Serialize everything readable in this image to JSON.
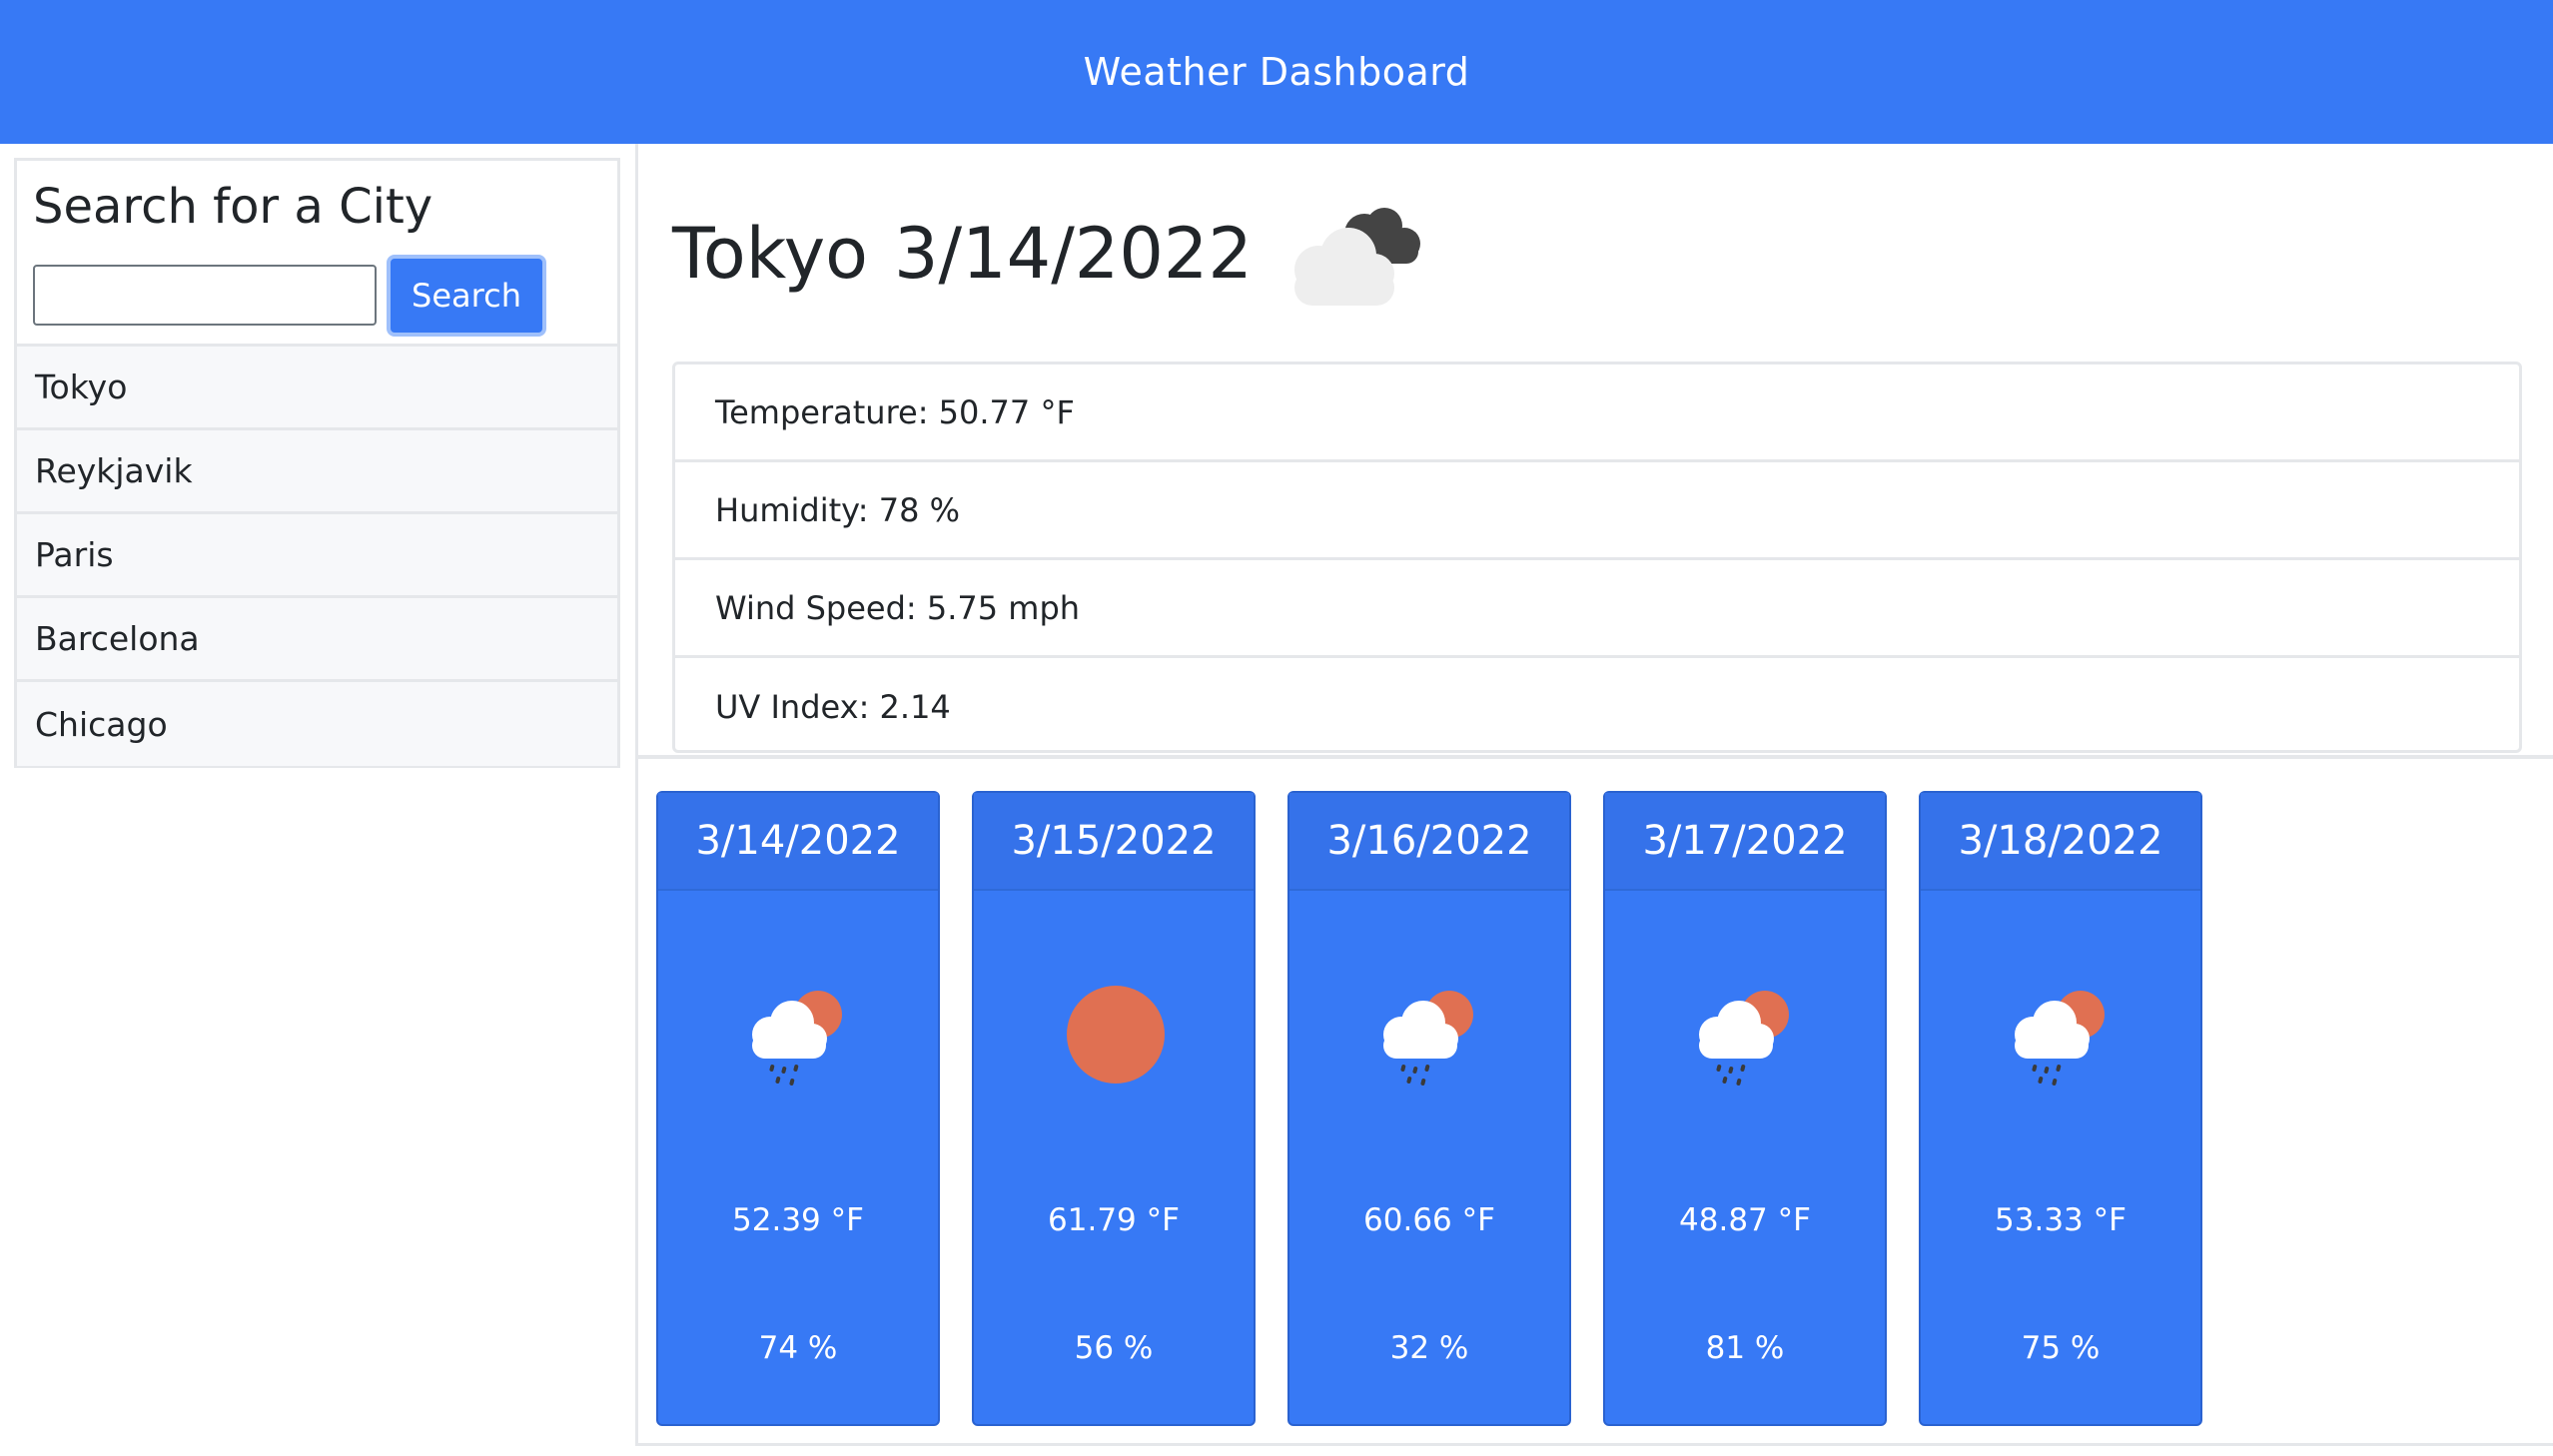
{
  "header": {
    "title": "Weather Dashboard"
  },
  "sidebar": {
    "heading": "Search for a City",
    "search": {
      "value": "",
      "placeholder": "",
      "button_label": "Search"
    },
    "cities": [
      "Tokyo",
      "Reykjavik",
      "Paris",
      "Barcelona",
      "Chicago"
    ]
  },
  "current": {
    "city": "Tokyo",
    "date": "3/14/2022",
    "icon": "broken-clouds-icon",
    "temperature": "Temperature: 50.77 °F",
    "humidity": "Humidity: 78 %",
    "wind": "Wind Speed: 5.75 mph",
    "uv": "UV Index: 2.14"
  },
  "forecast": [
    {
      "date": "3/14/2022",
      "icon": "rain-icon",
      "temp": "52.39 °F",
      "humidity": "74 %"
    },
    {
      "date": "3/15/2022",
      "icon": "clear-sky-icon",
      "temp": "61.79 °F",
      "humidity": "56 %"
    },
    {
      "date": "3/16/2022",
      "icon": "rain-icon",
      "temp": "60.66 °F",
      "humidity": "32 %"
    },
    {
      "date": "3/17/2022",
      "icon": "rain-icon",
      "temp": "48.87 °F",
      "humidity": "81 %"
    },
    {
      "date": "3/18/2022",
      "icon": "rain-icon",
      "temp": "53.33 °F",
      "humidity": "75 %"
    }
  ],
  "colors": {
    "primary": "#3779f5",
    "sun": "#e07052",
    "cloud_light": "#eeeeee",
    "cloud_dark": "#444444"
  }
}
